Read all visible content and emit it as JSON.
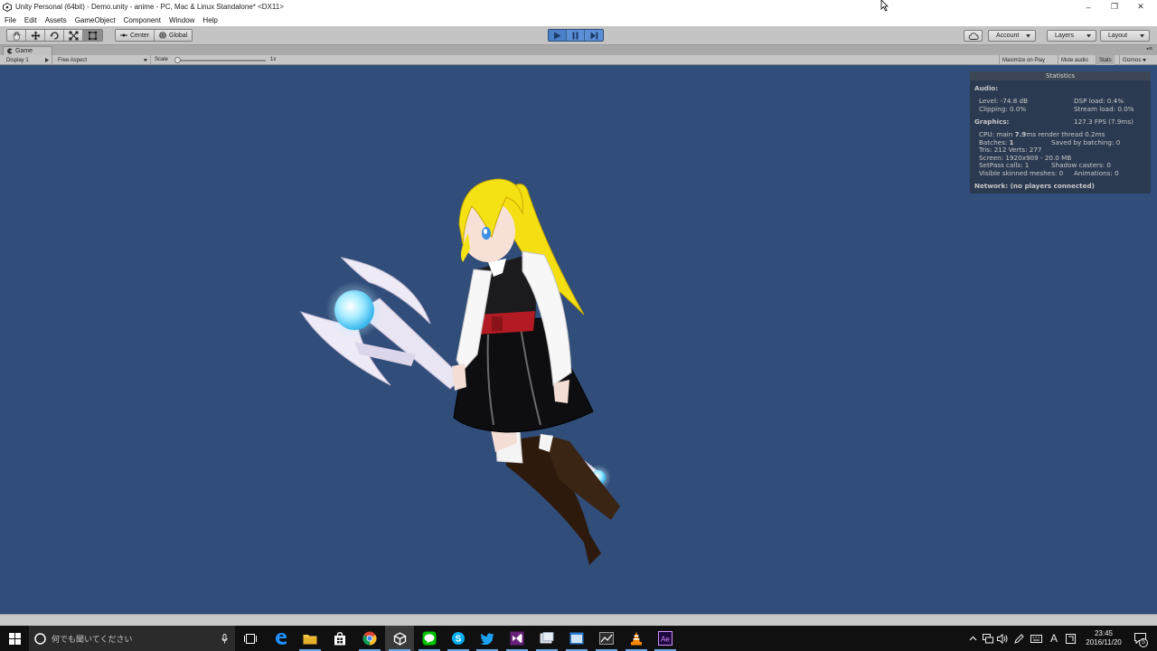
{
  "window": {
    "title": "Unity Personal (64bit) - Demo.unity - anime - PC, Mac & Linux Standalone* <DX11>",
    "controls": [
      "–",
      "❐",
      "✕"
    ]
  },
  "menu": [
    "File",
    "Edit",
    "Assets",
    "GameObject",
    "Component",
    "Window",
    "Help"
  ],
  "toolbar": {
    "tools": [
      "hand-tool",
      "move-tool",
      "rotate-tool",
      "scale-tool",
      "rect-tool"
    ],
    "pivot_label": "Center",
    "space_label": "Global",
    "account_label": "Account",
    "layers_label": "Layers",
    "layout_label": "Layout",
    "playing": true,
    "accent": "#4a80c8"
  },
  "game_tab": {
    "label": "Game",
    "display": "Display 1",
    "aspect": "Free Aspect",
    "scale_label": "Scale",
    "scale_value": "1x",
    "toggles": [
      "Maximize on Play",
      "Mute audio",
      "Stats",
      "Gizmos"
    ]
  },
  "game_view": {
    "background": "#314d79"
  },
  "stats": {
    "title": "Statistics",
    "audio_header": "Audio:",
    "level": "Level: -74.8 dB",
    "dsp_load": "DSP load: 0.4%",
    "clipping": "Clipping: 0.0%",
    "stream_load": "Stream load: 0.0%",
    "graphics_header": "Graphics:",
    "fps": "127.3 FPS (7.9ms)",
    "cpu_prefix": "CPU: main",
    "cpu_main": "7.9",
    "cpu_suffix": "ms  render thread 0.2ms",
    "batches_prefix": "Batches:",
    "batches_value": "1",
    "saved_batching": "Saved by batching: 0",
    "tris": "Tris: 212  Verts: 277",
    "screen": "Screen: 1920x909 - 20.0 MB",
    "setpass": "SetPass calls: 1",
    "shadow_casters": "Shadow casters: 0",
    "skinned": "Visible skinned meshes: 0",
    "animations": "Animations: 0",
    "network": "Network: (no players connected)"
  },
  "taskbar": {
    "search_placeholder": "何でも聞いてください",
    "apps": [
      "task-view",
      "edge",
      "file-explorer",
      "store",
      "chrome",
      "unity",
      "line",
      "skype",
      "twitter",
      "visual-studio",
      "app-generic",
      "app-blue",
      "app-graph",
      "vlc",
      "after-effects"
    ],
    "tray_ime": "A",
    "time": "23:45",
    "date": "2016/11/20",
    "notifications": "5"
  }
}
